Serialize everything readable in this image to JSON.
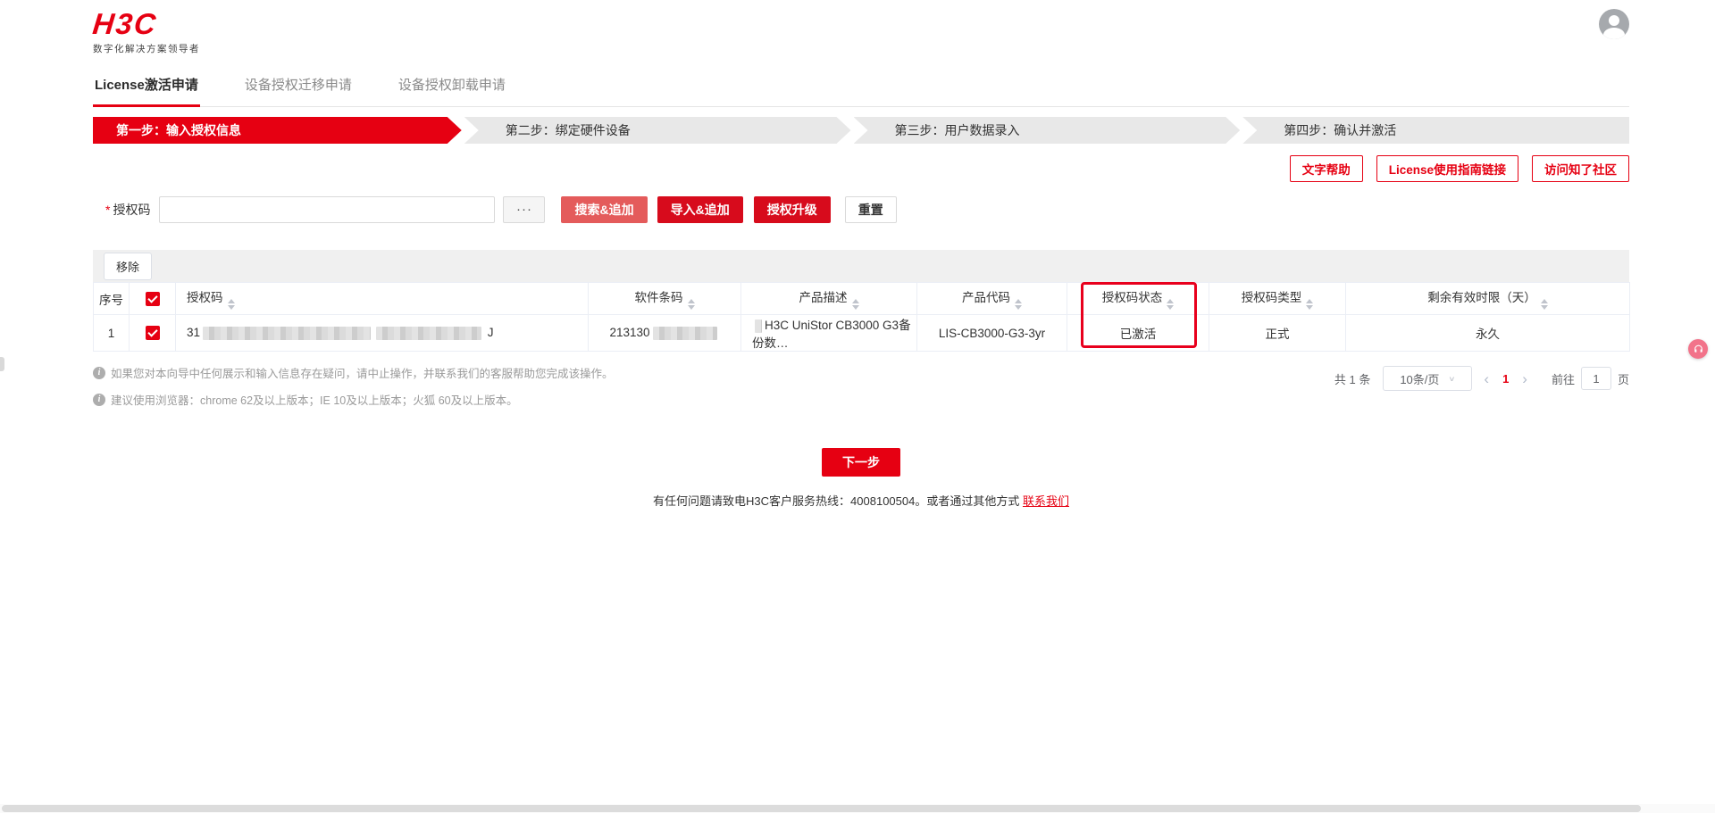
{
  "brand": {
    "logo": "H3C",
    "tagline": "数字化解决方案领导者"
  },
  "tabs": [
    {
      "label": "License激活申请"
    },
    {
      "label": "设备授权迁移申请"
    },
    {
      "label": "设备授权卸载申请"
    }
  ],
  "steps": [
    {
      "label": "第一步：输入授权信息"
    },
    {
      "label": "第二步：绑定硬件设备"
    },
    {
      "label": "第三步：用户数据录入"
    },
    {
      "label": "第四步：确认并激活"
    }
  ],
  "help_links": [
    {
      "label": "文字帮助"
    },
    {
      "label": "License使用指南链接"
    },
    {
      "label": "访问知了社区"
    }
  ],
  "form": {
    "required_mark": "*",
    "auth_code_label": "授权码",
    "input_value": "",
    "more_button": "···",
    "search_append": "搜索&追加",
    "import_append": "导入&追加",
    "upgrade": "授权升级",
    "reset": "重置"
  },
  "table": {
    "remove_button": "移除",
    "headers": {
      "index": "序号",
      "auth_code": "授权码",
      "software_barcode": "软件条码",
      "product_desc": "产品描述",
      "product_code": "产品代码",
      "auth_status": "授权码状态",
      "auth_type": "授权码类型",
      "remaining_days": "剩余有效时限（天）"
    },
    "rows": [
      {
        "index": "1",
        "auth_code_prefix": "31",
        "auth_code_suffix": "J",
        "barcode_prefix": "213130",
        "product_desc": "H3C UniStor CB3000 G3备份数…",
        "product_code": "LIS-CB3000-G3-3yr",
        "auth_status": "已激活",
        "auth_type": "正式",
        "remaining_days": "永久"
      }
    ]
  },
  "notes": [
    {
      "text": "如果您对本向导中任何展示和输入信息存在疑问，请中止操作，并联系我们的客服帮助您完成该操作。"
    },
    {
      "text": "建议使用浏览器：chrome 62及以上版本；IE 10及以上版本；火狐 60及以上版本。"
    }
  ],
  "pagination": {
    "total": "共 1 条",
    "page_size": "10条/页",
    "size_chevron": "∨",
    "prev": "‹",
    "next": "›",
    "current_page": "1",
    "goto_label": "前往",
    "goto_value": "1",
    "page_unit": "页"
  },
  "next_button": "下一步",
  "footer": {
    "text_before": "有任何问题请致电H3C客户服务热线：4008100504。或者通过其他方式 ",
    "contact_link": "联系我们"
  },
  "colors": {
    "brand_red": "#e60012",
    "button_red": "#d70b1c",
    "light_red": "#e45b5b",
    "step_grey": "#e8e8e8"
  }
}
